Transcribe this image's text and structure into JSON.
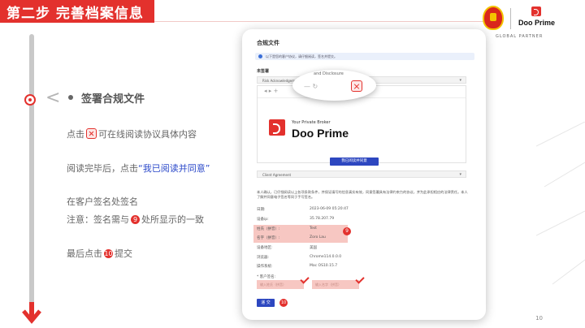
{
  "header": {
    "title": "第二步  完善档案信息"
  },
  "logos": {
    "partner_brand": "Doo Prime",
    "partner_caption": "GLOBAL PARTNER"
  },
  "step": {
    "heading": "签署合规文件"
  },
  "instructions": {
    "line1_pre": "点击",
    "line1_post": "可在线阅读协议具体内容",
    "line2_pre": "阅读完毕后，点击",
    "line2_link": "“我已阅读并同意”",
    "line3": "在客户签名处签名",
    "line4_pre": "注意：签名需与",
    "line4_num": "9",
    "line4_post": "处所显示的一致",
    "line5_pre": "最后点击",
    "line5_num": "10",
    "line5_post": "提交"
  },
  "device": {
    "title": "合规文件",
    "info": "以下是您的客户协议，请仔细阅读，签名并提交。",
    "unsigned_label": "未签署",
    "accordion1": "Risk Acknowledgement and Disclosure",
    "magnifier_text": "and Disclosure",
    "pdf_tagline": "Your Private Broker",
    "pdf_brand": "Doo Prime",
    "read_button": "我已阅读并同意",
    "accordion2": "Client Agreement",
    "consent": "本人确认，已仔细阅读以上各项条款条件，并保证填写的信息真实有效，同意签署具有法律约束力的协议，并为此承担相应的法律责任。本人了解并同意电子签名等同于手写签名。",
    "fields": [
      {
        "label": "日期:",
        "value": "2023-06-09 05:20:47"
      },
      {
        "label": "设备ip:",
        "value": "35.78.207.79"
      },
      {
        "label": "姓氏（拼音）:",
        "value": "Test"
      },
      {
        "label": "名字（拼音）:",
        "value": "Zoro Lau"
      },
      {
        "label": "设备地区:",
        "value": "美国"
      },
      {
        "label": "浏览器:",
        "value": "Chrome114.0.0.0"
      },
      {
        "label": "操作系统:",
        "value": "Mac OS10.15.7"
      }
    ],
    "badge9": "9",
    "signature_label": "* 客户签名:",
    "sig_placeholder_1": "输入姓氏（拼音）",
    "sig_placeholder_2": "输入名字（拼音）",
    "submit_button": "递 交",
    "badge10": "10"
  },
  "page_number": "10",
  "colors": {
    "accent": "#e3312d",
    "button_blue": "#2d47c0",
    "highlight": "#f7c7c2"
  }
}
